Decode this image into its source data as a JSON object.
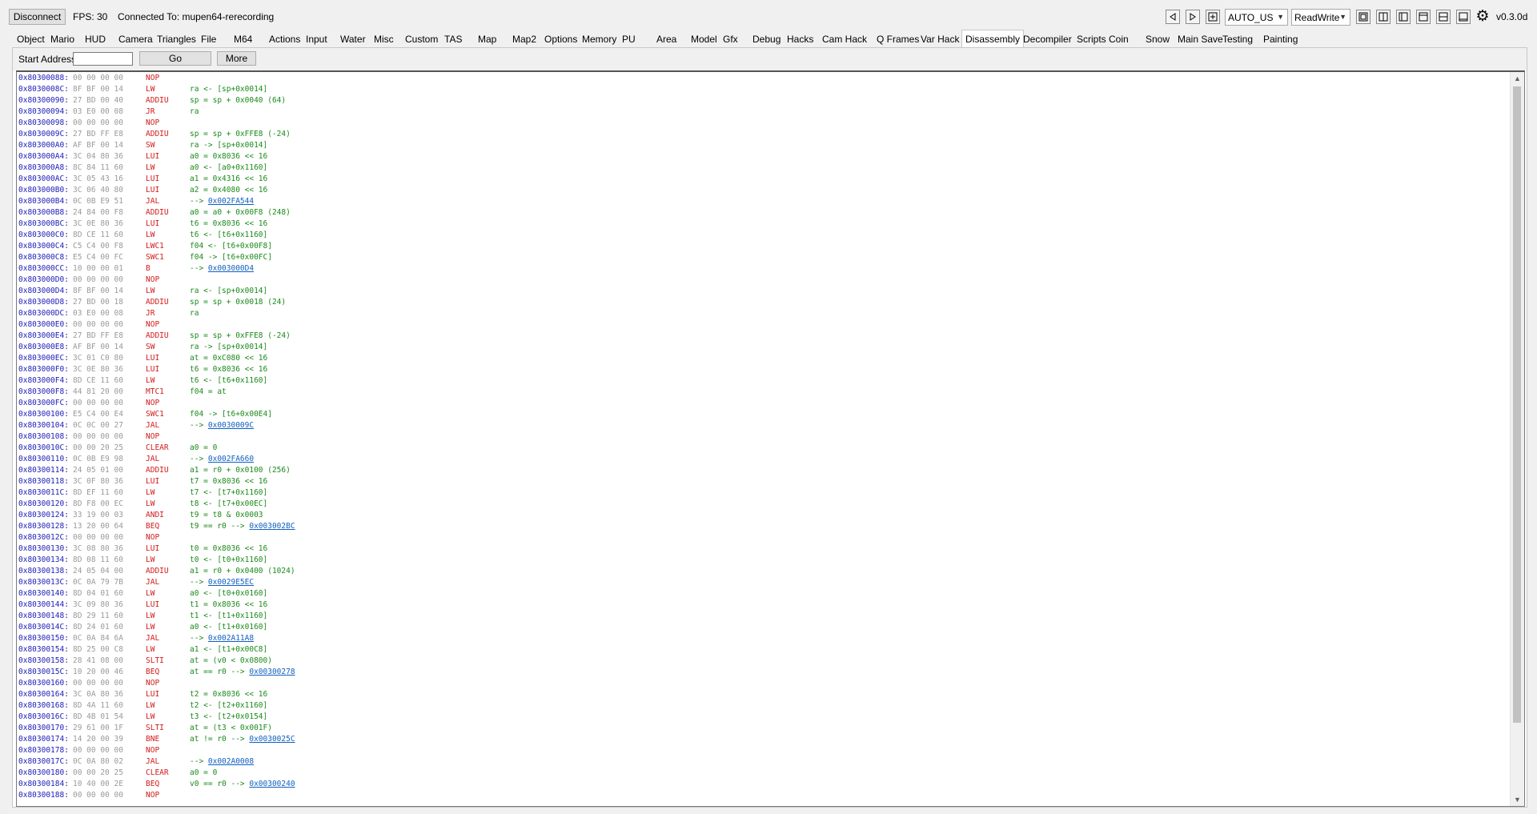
{
  "toolbar": {
    "disconnect_label": "Disconnect",
    "fps_text": "FPS: 30",
    "connection_text": "Connected To: mupen64-rerecording",
    "version_text": "v0.3.0d",
    "combo_region": "AUTO_US",
    "combo_mode": "ReadWrite",
    "icons": [
      "triangle-left-icon",
      "triangle-right-icon",
      "plus-box-icon",
      "single-panel-icon",
      "split-vertical-icon",
      "left-pane-icon",
      "top-pane-icon",
      "split-horizontal-icon",
      "window-icon",
      "gear-icon"
    ]
  },
  "tabs": [
    "Object",
    "Mario",
    "HUD",
    "Camera",
    "Triangles",
    "File",
    "M64",
    "Actions",
    "Input",
    "Water",
    "Misc",
    "Custom",
    "TAS",
    "Map",
    "Map2",
    "Options",
    "Memory",
    "PU",
    "Area",
    "Model",
    "Gfx",
    "Debug",
    "Hacks",
    "Cam Hack",
    "Q Frames",
    "Var Hack",
    "Disassembly",
    "Decompiler",
    "Scripts",
    "Coin",
    "Snow",
    "Main Save",
    "Testing",
    "Painting"
  ],
  "active_tab": "Disassembly",
  "disassembly": {
    "start_address_label": "Start Address:",
    "start_address_value": "",
    "go_label": "Go",
    "more_label": "More",
    "rows": [
      {
        "addr": "0x80300088:",
        "bytes": "00 00 00 00",
        "op": "NOP",
        "args": "",
        "link": ""
      },
      {
        "addr": "0x8030008C:",
        "bytes": "8F BF 00 14",
        "op": "LW",
        "args": "ra <- [sp+0x0014]",
        "link": ""
      },
      {
        "addr": "0x80300090:",
        "bytes": "27 BD 00 40",
        "op": "ADDIU",
        "args": "sp = sp + 0x0040 (64)",
        "link": ""
      },
      {
        "addr": "0x80300094:",
        "bytes": "03 E0 00 08",
        "op": "JR",
        "args": "ra",
        "link": ""
      },
      {
        "addr": "0x80300098:",
        "bytes": "00 00 00 00",
        "op": "NOP",
        "args": "",
        "link": ""
      },
      {
        "addr": "0x8030009C:",
        "bytes": "27 BD FF E8",
        "op": "ADDIU",
        "args": "sp = sp + 0xFFE8 (-24)",
        "link": ""
      },
      {
        "addr": "0x803000A0:",
        "bytes": "AF BF 00 14",
        "op": "SW",
        "args": "ra -> [sp+0x0014]",
        "link": ""
      },
      {
        "addr": "0x803000A4:",
        "bytes": "3C 04 80 36",
        "op": "LUI",
        "args": "a0 = 0x8036 << 16",
        "link": ""
      },
      {
        "addr": "0x803000A8:",
        "bytes": "8C 84 11 60",
        "op": "LW",
        "args": "a0 <- [a0+0x1160]",
        "link": ""
      },
      {
        "addr": "0x803000AC:",
        "bytes": "3C 05 43 16",
        "op": "LUI",
        "args": "a1 = 0x4316 << 16",
        "link": ""
      },
      {
        "addr": "0x803000B0:",
        "bytes": "3C 06 40 80",
        "op": "LUI",
        "args": "a2 = 0x4080 << 16",
        "link": ""
      },
      {
        "addr": "0x803000B4:",
        "bytes": "0C 0B E9 51",
        "op": "JAL",
        "args": "--> ",
        "link": "0x002FA544"
      },
      {
        "addr": "0x803000B8:",
        "bytes": "24 84 00 F8",
        "op": "ADDIU",
        "args": "a0 = a0 + 0x00F8 (248)",
        "link": ""
      },
      {
        "addr": "0x803000BC:",
        "bytes": "3C 0E 80 36",
        "op": "LUI",
        "args": "t6 = 0x8036 << 16",
        "link": ""
      },
      {
        "addr": "0x803000C0:",
        "bytes": "8D CE 11 60",
        "op": "LW",
        "args": "t6 <- [t6+0x1160]",
        "link": ""
      },
      {
        "addr": "0x803000C4:",
        "bytes": "C5 C4 00 F8",
        "op": "LWC1",
        "args": "f04 <- [t6+0x00F8]",
        "link": ""
      },
      {
        "addr": "0x803000C8:",
        "bytes": "E5 C4 00 FC",
        "op": "SWC1",
        "args": "f04 -> [t6+0x00FC]",
        "link": ""
      },
      {
        "addr": "0x803000CC:",
        "bytes": "10 00 00 01",
        "op": "B",
        "args": "--> ",
        "link": "0x003000D4"
      },
      {
        "addr": "0x803000D0:",
        "bytes": "00 00 00 00",
        "op": "NOP",
        "args": "",
        "link": ""
      },
      {
        "addr": "0x803000D4:",
        "bytes": "8F BF 00 14",
        "op": "LW",
        "args": "ra <- [sp+0x0014]",
        "link": ""
      },
      {
        "addr": "0x803000D8:",
        "bytes": "27 BD 00 18",
        "op": "ADDIU",
        "args": "sp = sp + 0x0018 (24)",
        "link": ""
      },
      {
        "addr": "0x803000DC:",
        "bytes": "03 E0 00 08",
        "op": "JR",
        "args": "ra",
        "link": ""
      },
      {
        "addr": "0x803000E0:",
        "bytes": "00 00 00 00",
        "op": "NOP",
        "args": "",
        "link": ""
      },
      {
        "addr": "0x803000E4:",
        "bytes": "27 BD FF E8",
        "op": "ADDIU",
        "args": "sp = sp + 0xFFE8 (-24)",
        "link": ""
      },
      {
        "addr": "0x803000E8:",
        "bytes": "AF BF 00 14",
        "op": "SW",
        "args": "ra -> [sp+0x0014]",
        "link": ""
      },
      {
        "addr": "0x803000EC:",
        "bytes": "3C 01 C0 80",
        "op": "LUI",
        "args": "at = 0xC080 << 16",
        "link": ""
      },
      {
        "addr": "0x803000F0:",
        "bytes": "3C 0E 80 36",
        "op": "LUI",
        "args": "t6 = 0x8036 << 16",
        "link": ""
      },
      {
        "addr": "0x803000F4:",
        "bytes": "8D CE 11 60",
        "op": "LW",
        "args": "t6 <- [t6+0x1160]",
        "link": ""
      },
      {
        "addr": "0x803000F8:",
        "bytes": "44 81 20 00",
        "op": "MTC1",
        "args": "f04 = at",
        "link": ""
      },
      {
        "addr": "0x803000FC:",
        "bytes": "00 00 00 00",
        "op": "NOP",
        "args": "",
        "link": ""
      },
      {
        "addr": "0x80300100:",
        "bytes": "E5 C4 00 E4",
        "op": "SWC1",
        "args": "f04 -> [t6+0x00E4]",
        "link": ""
      },
      {
        "addr": "0x80300104:",
        "bytes": "0C 0C 00 27",
        "op": "JAL",
        "args": "--> ",
        "link": "0x0030009C"
      },
      {
        "addr": "0x80300108:",
        "bytes": "00 00 00 00",
        "op": "NOP",
        "args": "",
        "link": ""
      },
      {
        "addr": "0x8030010C:",
        "bytes": "00 00 20 25",
        "op": "CLEAR",
        "args": "a0 = 0",
        "link": ""
      },
      {
        "addr": "0x80300110:",
        "bytes": "0C 0B E9 98",
        "op": "JAL",
        "args": "--> ",
        "link": "0x002FA660"
      },
      {
        "addr": "0x80300114:",
        "bytes": "24 05 01 00",
        "op": "ADDIU",
        "args": "a1 = r0 + 0x0100 (256)",
        "link": ""
      },
      {
        "addr": "0x80300118:",
        "bytes": "3C 0F 80 36",
        "op": "LUI",
        "args": "t7 = 0x8036 << 16",
        "link": ""
      },
      {
        "addr": "0x8030011C:",
        "bytes": "8D EF 11 60",
        "op": "LW",
        "args": "t7 <- [t7+0x1160]",
        "link": ""
      },
      {
        "addr": "0x80300120:",
        "bytes": "8D F8 00 EC",
        "op": "LW",
        "args": "t8 <- [t7+0x00EC]",
        "link": ""
      },
      {
        "addr": "0x80300124:",
        "bytes": "33 19 00 03",
        "op": "ANDI",
        "args": "t9 = t8 & 0x0003",
        "link": ""
      },
      {
        "addr": "0x80300128:",
        "bytes": "13 20 00 64",
        "op": "BEQ",
        "args": "t9 == r0 --> ",
        "link": "0x003002BC"
      },
      {
        "addr": "0x8030012C:",
        "bytes": "00 00 00 00",
        "op": "NOP",
        "args": "",
        "link": ""
      },
      {
        "addr": "0x80300130:",
        "bytes": "3C 08 80 36",
        "op": "LUI",
        "args": "t0 = 0x8036 << 16",
        "link": ""
      },
      {
        "addr": "0x80300134:",
        "bytes": "8D 08 11 60",
        "op": "LW",
        "args": "t0 <- [t0+0x1160]",
        "link": ""
      },
      {
        "addr": "0x80300138:",
        "bytes": "24 05 04 00",
        "op": "ADDIU",
        "args": "a1 = r0 + 0x0400 (1024)",
        "link": ""
      },
      {
        "addr": "0x8030013C:",
        "bytes": "0C 0A 79 7B",
        "op": "JAL",
        "args": "--> ",
        "link": "0x0029E5EC"
      },
      {
        "addr": "0x80300140:",
        "bytes": "8D 04 01 60",
        "op": "LW",
        "args": "a0 <- [t0+0x0160]",
        "link": ""
      },
      {
        "addr": "0x80300144:",
        "bytes": "3C 09 80 36",
        "op": "LUI",
        "args": "t1 = 0x8036 << 16",
        "link": ""
      },
      {
        "addr": "0x80300148:",
        "bytes": "8D 29 11 60",
        "op": "LW",
        "args": "t1 <- [t1+0x1160]",
        "link": ""
      },
      {
        "addr": "0x8030014C:",
        "bytes": "8D 24 01 60",
        "op": "LW",
        "args": "a0 <- [t1+0x0160]",
        "link": ""
      },
      {
        "addr": "0x80300150:",
        "bytes": "0C 0A 84 6A",
        "op": "JAL",
        "args": "--> ",
        "link": "0x002A11A8"
      },
      {
        "addr": "0x80300154:",
        "bytes": "8D 25 00 C8",
        "op": "LW",
        "args": "a1 <- [t1+0x00C8]",
        "link": ""
      },
      {
        "addr": "0x80300158:",
        "bytes": "28 41 08 00",
        "op": "SLTI",
        "args": "at = (v0 < 0x0800)",
        "link": ""
      },
      {
        "addr": "0x8030015C:",
        "bytes": "10 20 00 46",
        "op": "BEQ",
        "args": "at == r0 --> ",
        "link": "0x00300278"
      },
      {
        "addr": "0x80300160:",
        "bytes": "00 00 00 00",
        "op": "NOP",
        "args": "",
        "link": ""
      },
      {
        "addr": "0x80300164:",
        "bytes": "3C 0A 80 36",
        "op": "LUI",
        "args": "t2 = 0x8036 << 16",
        "link": ""
      },
      {
        "addr": "0x80300168:",
        "bytes": "8D 4A 11 60",
        "op": "LW",
        "args": "t2 <- [t2+0x1160]",
        "link": ""
      },
      {
        "addr": "0x8030016C:",
        "bytes": "8D 4B 01 54",
        "op": "LW",
        "args": "t3 <- [t2+0x0154]",
        "link": ""
      },
      {
        "addr": "0x80300170:",
        "bytes": "29 61 00 1F",
        "op": "SLTI",
        "args": "at = (t3 < 0x001F)",
        "link": ""
      },
      {
        "addr": "0x80300174:",
        "bytes": "14 20 00 39",
        "op": "BNE",
        "args": "at != r0 --> ",
        "link": "0x0030025C"
      },
      {
        "addr": "0x80300178:",
        "bytes": "00 00 00 00",
        "op": "NOP",
        "args": "",
        "link": ""
      },
      {
        "addr": "0x8030017C:",
        "bytes": "0C 0A 80 02",
        "op": "JAL",
        "args": "--> ",
        "link": "0x002A0008"
      },
      {
        "addr": "0x80300180:",
        "bytes": "00 00 20 25",
        "op": "CLEAR",
        "args": "a0 = 0",
        "link": ""
      },
      {
        "addr": "0x80300184:",
        "bytes": "10 40 00 2E",
        "op": "BEQ",
        "args": "v0 == r0 --> ",
        "link": "0x00300240"
      },
      {
        "addr": "0x80300188:",
        "bytes": "00 00 00 00",
        "op": "NOP",
        "args": "",
        "link": ""
      }
    ]
  },
  "colors": {
    "address": "#1c1cb8",
    "bytes": "#9a9a9a",
    "opcode": "#d11a1a",
    "operands": "#1a8a1a",
    "link": "#1060c0"
  }
}
